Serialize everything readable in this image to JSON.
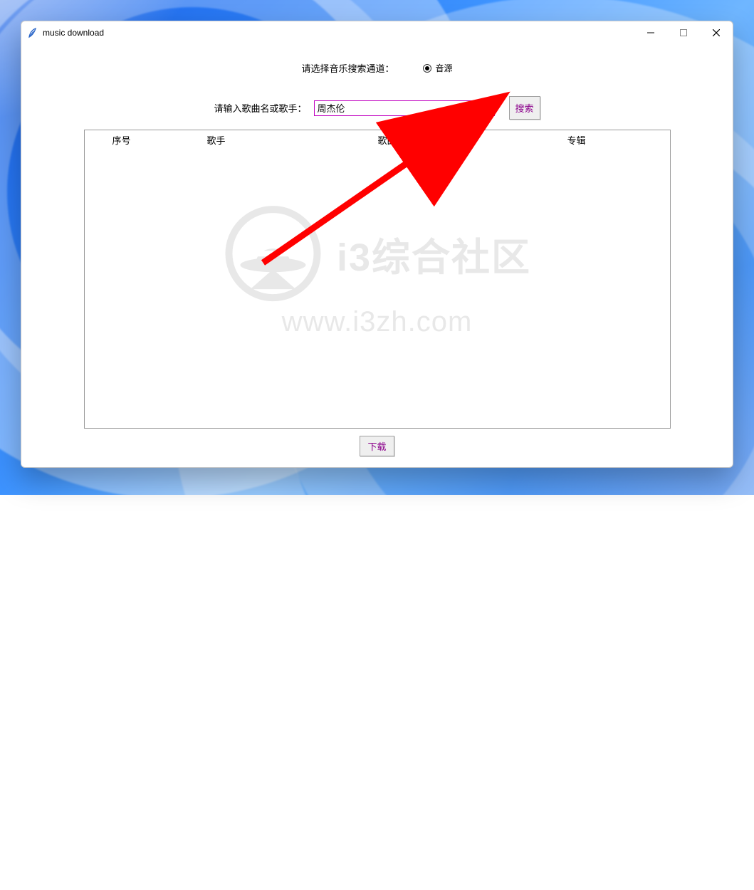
{
  "window": {
    "title": "music download"
  },
  "channel": {
    "label": "请选择音乐搜索通道：",
    "option_label": "音源",
    "selected": true
  },
  "search": {
    "label": "请输入歌曲名或歌手：",
    "value": "周杰伦",
    "button_label": "搜索"
  },
  "columns": {
    "index": "序号",
    "singer": "歌手",
    "song": "歌曲",
    "album": "专辑"
  },
  "download": {
    "button_label": "下载"
  },
  "watermark": {
    "prefix": "i3",
    "cn": "综合社区",
    "en": "www.i3zh.com"
  },
  "colors": {
    "accent_purple": "#8b008b",
    "input_border": "#c000c0",
    "annotation_red": "#ff0000"
  }
}
